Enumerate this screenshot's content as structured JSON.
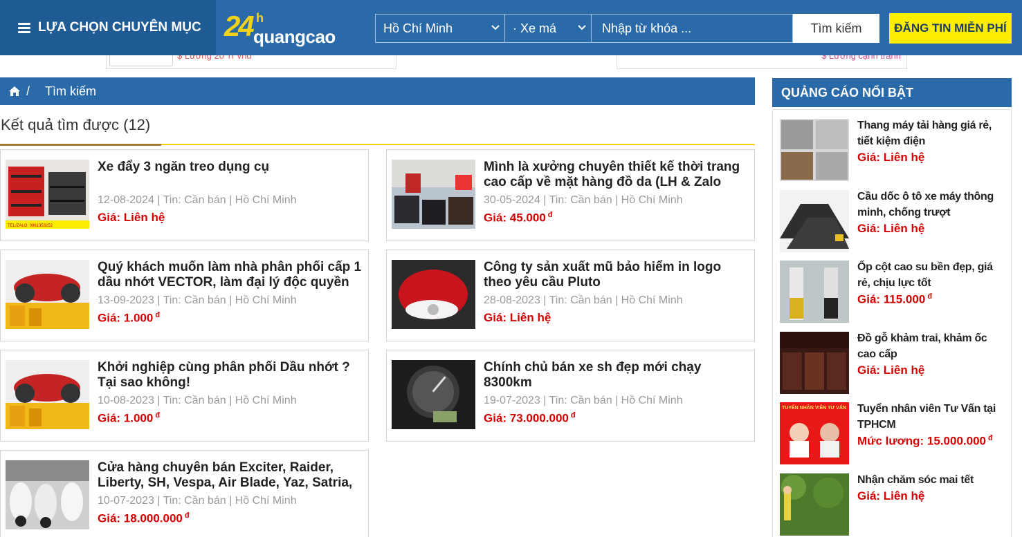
{
  "header": {
    "category_label": "LỰA CHỌN CHUYÊN MỤC",
    "logo_number": "24",
    "logo_h": "h",
    "logo_text": "quangcao",
    "location_selected": "Hồ Chí Minh",
    "category_selected": "· Xe má",
    "search_placeholder": "Nhập từ khóa ...",
    "search_button": "Tìm kiếm",
    "post_button": "ĐĂNG TIN MIỄN PHÍ"
  },
  "top_ads": {
    "left_salary": "$ Lương 20 Tr vnđ",
    "right_salary": "$ Lương cạnh tranh"
  },
  "breadcrumb": {
    "separator": "/",
    "current": "Tìm kiếm"
  },
  "results": {
    "heading": "Kết quả tìm được (12)",
    "currency": "đ",
    "price_prefix": "Giá:",
    "items": [
      {
        "title": "Xe đẩy 3 ngăn treo dụng cụ",
        "meta": "12-08-2024 | Tin: Cần bán | Hồ Chí Minh",
        "price": "Liên hệ",
        "has_currency": false
      },
      {
        "title": "Mình là xưởng chuyên thiết kế thời trang cao cấp về mặt hàng đồ da (LH & Zalo",
        "meta": "30-05-2024 | Tin: Cần bán | Hồ Chí Minh",
        "price": "45.000",
        "has_currency": true
      },
      {
        "title": "Quý khách muốn làm nhà phân phối cấp 1 dầu nhớt VECTOR, làm đại lý độc quyền",
        "meta": "13-09-2023 | Tin: Cần bán | Hồ Chí Minh",
        "price": "1.000",
        "has_currency": true
      },
      {
        "title": "Công ty sản xuất mũ bảo hiểm in logo theo yêu cầu Pluto",
        "meta": "28-08-2023 | Tin: Cần bán | Hồ Chí Minh",
        "price": "Liên hệ",
        "has_currency": false
      },
      {
        "title": "Khởi nghiệp cùng phân phối Dầu nhớt ? Tại sao không!",
        "meta": "10-08-2023 | Tin: Cần bán | Hồ Chí Minh",
        "price": "1.000",
        "has_currency": true
      },
      {
        "title": "Chính chủ bán xe sh đẹp mới chạy 8300km",
        "meta": "19-07-2023 | Tin: Cần bán | Hồ Chí Minh",
        "price": "73.000.000",
        "has_currency": true
      },
      {
        "title": "Cửa hàng chuyên bán Exciter, Raider, Liberty, SH, Vespa, Air Blade, Yaz, Satria,",
        "meta": "10-07-2023 | Tin: Cần bán | Hồ Chí Minh",
        "price": "18.000.000",
        "has_currency": true
      }
    ]
  },
  "sidebar": {
    "heading": "QUẢNG CÁO NỔI BẬT",
    "items": [
      {
        "title": "Thang máy tải hàng giá rẻ, tiết kiệm điện",
        "price_label": "Giá: Liên hệ",
        "currency": ""
      },
      {
        "title": "Cầu dốc ô tô xe máy thông minh, chống trượt",
        "price_label": "Giá: Liên hệ",
        "currency": ""
      },
      {
        "title": "Ốp cột cao su bền đẹp, giá rẻ, chịu lực tốt",
        "price_label": "Giá: 115.000",
        "currency": "đ"
      },
      {
        "title": "Đồ gỗ khảm trai, khảm ốc cao cấp",
        "price_label": "Giá: Liên hệ",
        "currency": ""
      },
      {
        "title": "Tuyển nhân viên Tư Vấn tại TPHCM",
        "price_label": "Mức lương: 15.000.000",
        "currency": "đ"
      },
      {
        "title": "Nhận chăm sóc mai tết",
        "price_label": "Giá: Liên hệ",
        "currency": ""
      }
    ]
  },
  "image_text": {
    "tel_label": "TEL/ZALO: 0961353252",
    "recruit_banner": "TUYỂN NHÂN VIÊN TƯ VẤN"
  },
  "colors": {
    "header_blue": "#2a6aa8",
    "header_dark_blue": "#1f5c96",
    "post_yellow": "#ffee00",
    "price_red": "#d40000",
    "accent_gold": "#f0d000"
  }
}
